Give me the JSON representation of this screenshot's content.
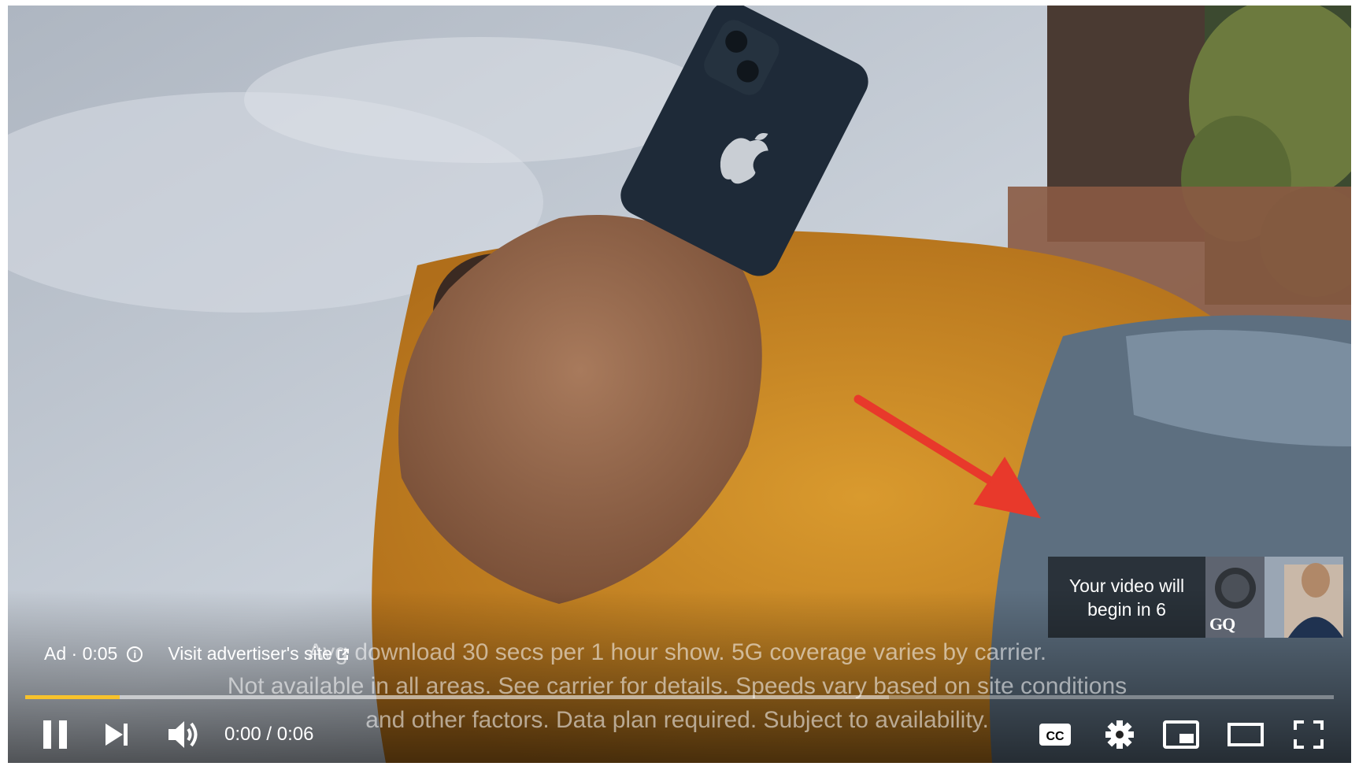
{
  "ad": {
    "label": "Ad · 0:05",
    "info_icon": "info-icon",
    "visit_label": "Visit advertiser's site",
    "external_icon": "external-link-icon"
  },
  "disclaimer": {
    "line1": "Avg download 30 secs per 1 hour show. 5G coverage varies by carrier.",
    "line2": "Not available in all areas. See carrier for details. Speeds vary based on site conditions",
    "line3": "and other factors. Data plan required. Subject to availability."
  },
  "skip": {
    "line1": "Your video will",
    "line2": "begin in 6",
    "thumb_logo": "GQ"
  },
  "progress": {
    "played_fraction": 0.072,
    "buffered_fraction": 0.66,
    "played_color": "#f7c22c"
  },
  "controls": {
    "time": "0:00 / 0:06",
    "icons": [
      "pause-icon",
      "next-icon",
      "volume-icon",
      "cc-icon",
      "settings-icon",
      "miniplayer-icon",
      "theater-icon",
      "fullscreen-icon"
    ],
    "cc_label": "CC"
  },
  "annotation": {
    "arrow_color": "#e8392b"
  }
}
